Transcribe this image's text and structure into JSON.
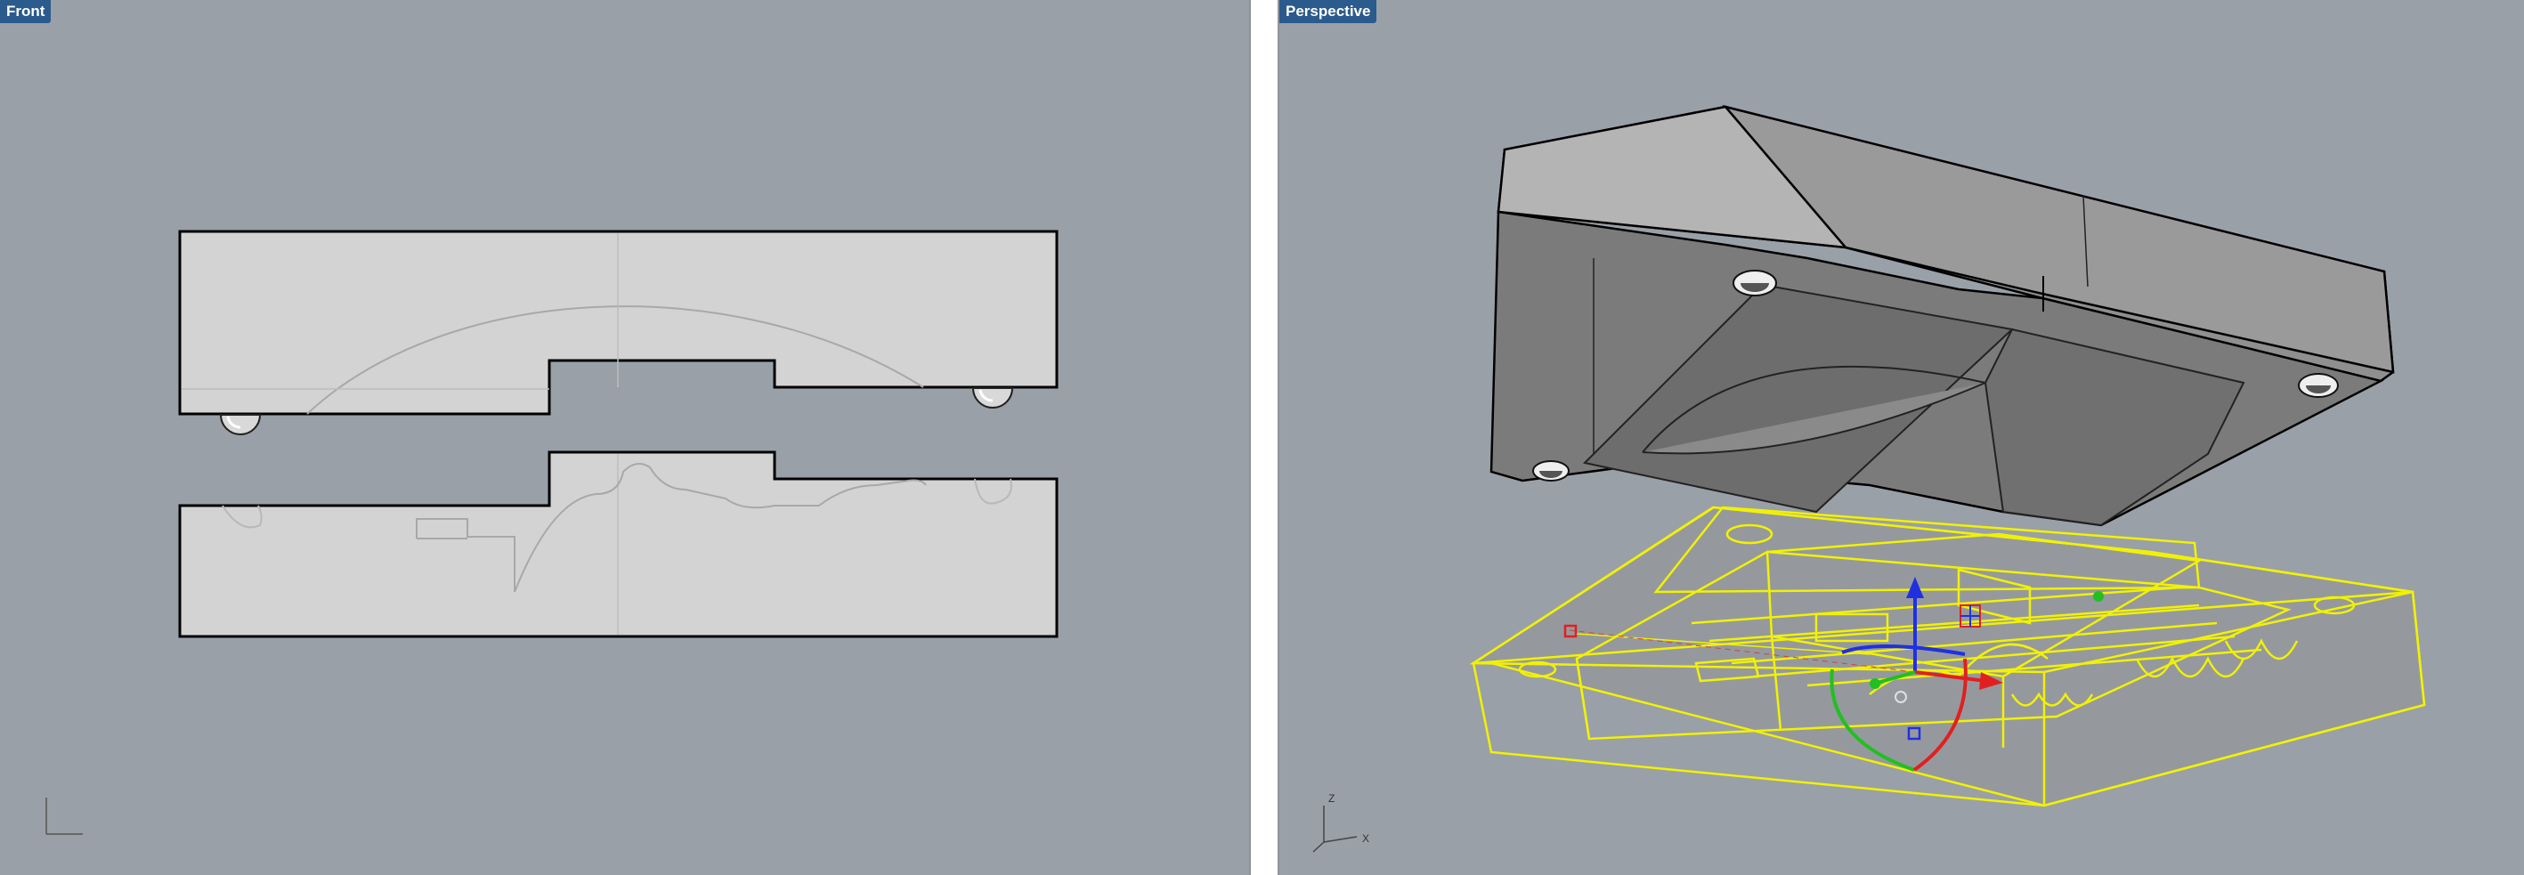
{
  "viewports": {
    "front": {
      "title": "Front"
    },
    "perspective": {
      "title": "Perspective"
    }
  },
  "axes": {
    "perspective": {
      "z": "Z",
      "x": "X"
    }
  },
  "colors": {
    "viewport_background": "#9aa0a8",
    "tab_background": "#2b5a8c",
    "selection": "#f2f200",
    "gumball_x": "#e02020",
    "gumball_y": "#20c020",
    "gumball_z": "#2030e0"
  }
}
